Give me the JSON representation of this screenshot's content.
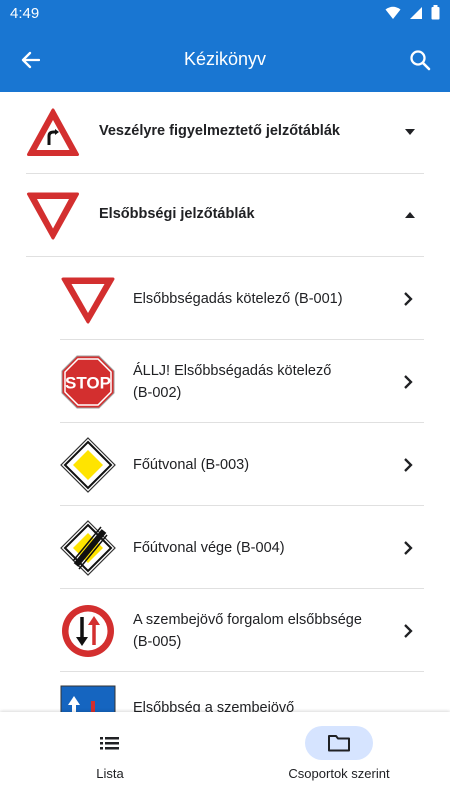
{
  "status": {
    "time": "4:49"
  },
  "app_bar": {
    "title": "Kézikönyv"
  },
  "categories": [
    {
      "label": "Veszélyre figyelmeztető jelzőtáblák",
      "expanded": false,
      "icon": "warning-sign-icon"
    },
    {
      "label": "Elsőbbségi jelzőtáblák",
      "expanded": true,
      "icon": "yield-sign-icon"
    }
  ],
  "items": [
    {
      "line1": "Elsőbbségadás kötelező (B-001)",
      "line2": "",
      "icon": "yield-sign-icon"
    },
    {
      "line1": "ÁLLJ! Elsőbbségadás kötelező",
      "line2": "(B-002)",
      "icon": "stop-sign-icon",
      "sign_text": "STOP"
    },
    {
      "line1": "Főútvonal (B-003)",
      "line2": "",
      "icon": "priority-road-sign-icon"
    },
    {
      "line1": "Főútvonal vége (B-004)",
      "line2": "",
      "icon": "end-priority-road-sign-icon"
    },
    {
      "line1": "A szembejövő forgalom elsőbbsége",
      "line2": "(B-005)",
      "icon": "oncoming-priority-sign-icon"
    },
    {
      "line1": "Elsőbbség a szembejövő",
      "line2": "",
      "icon": "priority-over-oncoming-sign-icon"
    }
  ],
  "bottom_nav": {
    "list_label": "Lista",
    "groups_label": "Csoportok szerint",
    "active": "groups"
  },
  "colors": {
    "primary": "#1976d2",
    "sign_red": "#d32f2f",
    "sign_yellow": "#ffe400",
    "nav_active": "#d6e4ff"
  }
}
